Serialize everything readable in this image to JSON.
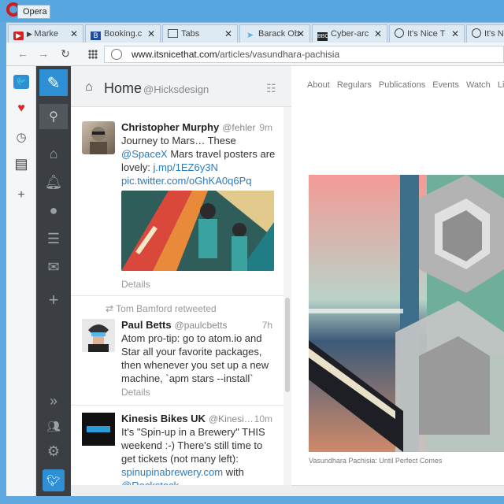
{
  "window": {
    "app_name": "Opera"
  },
  "tabs": [
    {
      "label": "Marke",
      "icon": "youtube-icon",
      "color": "#d32020"
    },
    {
      "label": "Booking.c",
      "icon": "booking-icon",
      "color": "#1e4c9a"
    },
    {
      "label": "Tabs",
      "icon": "window-icon",
      "color": "#555555"
    },
    {
      "label": "Barack Ob",
      "icon": "twitter-bird-icon",
      "color": "#55acee"
    },
    {
      "label": "Cyber-arc",
      "icon": "bbc-icon",
      "color": "#222222"
    },
    {
      "label": "It's Nice T",
      "icon": "globe-icon",
      "color": "#444444"
    },
    {
      "label": "It's Nice",
      "icon": "globe-icon",
      "color": "#444444"
    }
  ],
  "address_bar": {
    "domain": "www.itsnicethat.com",
    "path": "/articles/vasundhara-pachisia"
  },
  "tweetdeck": {
    "column_title": "Home",
    "column_handle": "@Hicksdesign",
    "details_label": "Details",
    "tweets": [
      {
        "name": "Christopher Murphy",
        "handle": "@fehler",
        "time": "9m",
        "text_1": "Journey to Mars… These ",
        "link_1": "@SpaceX",
        "text_2": " Mars travel posters are lovely: ",
        "link_2": "j.mp/1EZ6y3N",
        "link_3": "pic.twitter.com/oGhKA0q6Pq"
      },
      {
        "retweeted_by": "Tom Bamford retweeted",
        "name": "Paul Betts",
        "handle": "@paulcbetts",
        "time": "7h",
        "text": "Atom pro-tip: go to atom.io and Star all your favorite packages, then whenever you set up a new machine, `apm stars --install`"
      },
      {
        "name": "Kinesis Bikes UK",
        "handle": "@Kinesi…",
        "time": "10m",
        "text_1": "It's \"Spin-up in a Brewery\" THIS weekend :-) There's still time to get tickets (not many left): ",
        "link_1": "spinupinabrewery.com",
        "text_2": " with",
        "link_2": "@Rockstock"
      }
    ]
  },
  "webpage": {
    "nav": [
      "About",
      "Regulars",
      "Publications",
      "Events",
      "Watch",
      "Liste"
    ],
    "caption": "Vasundhara Pachisia: Until Perfect Comes"
  },
  "colors": {
    "frame": "#5fa9e0",
    "tweetdeck_nav": "#3b3f44",
    "accent": "#2f8fd4",
    "link": "#2b7bbf"
  }
}
